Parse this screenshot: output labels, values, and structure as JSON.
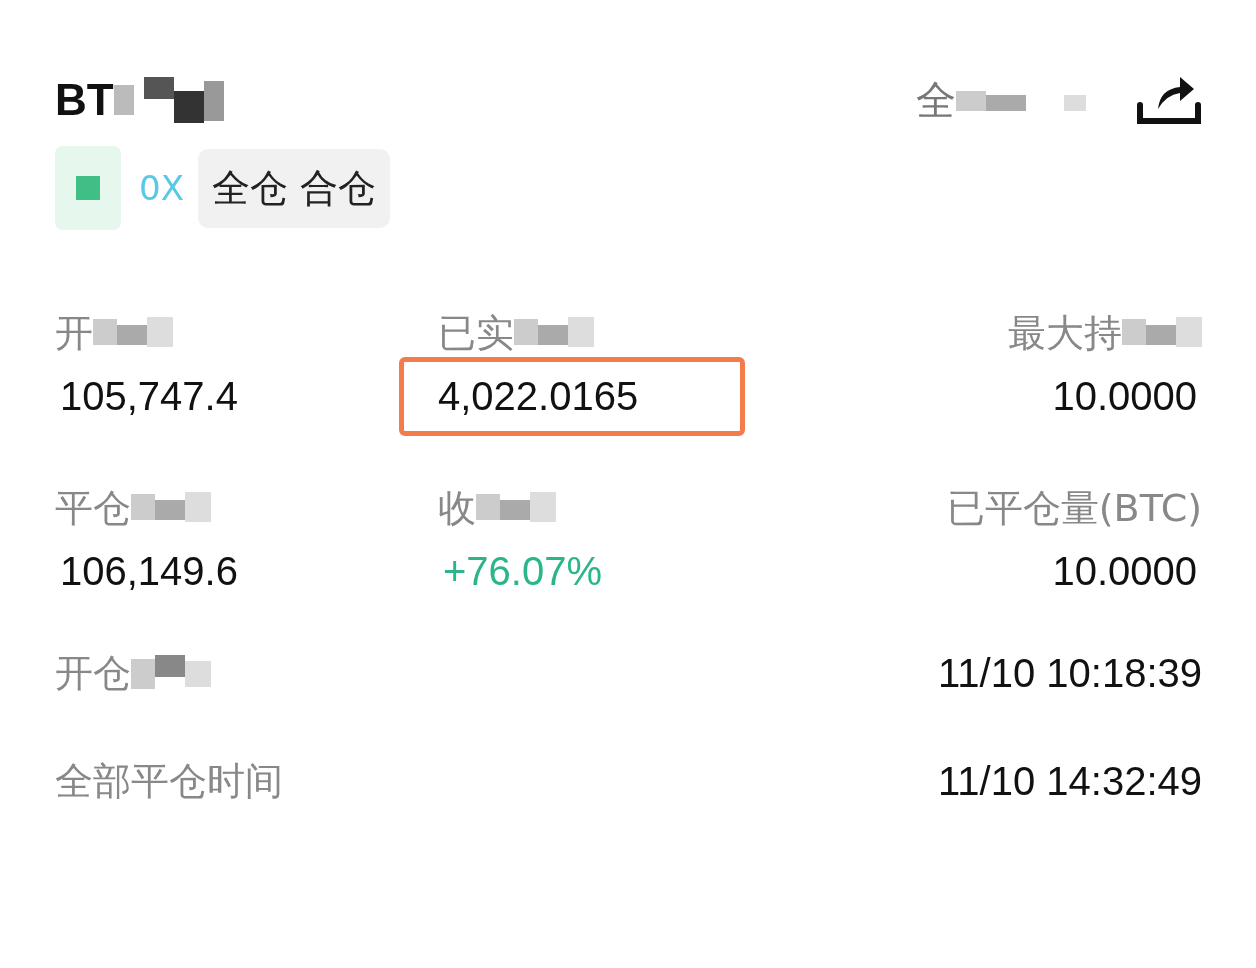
{
  "header": {
    "title": "BT",
    "filter": "全"
  },
  "tags": [
    {
      "kind": "exchange",
      "label": "0X"
    },
    {
      "kind": "mode",
      "label": "全仓 合仓"
    }
  ],
  "stats": [
    {
      "label": "开",
      "value": "105,747.4",
      "kind": "plain",
      "highlighted": false,
      "redacted": true
    },
    {
      "label": "已实",
      "value": "4,022.0165",
      "kind": "plain",
      "highlighted": true,
      "redacted": true
    },
    {
      "label": "最大持",
      "value": "10.0000",
      "kind": "plain",
      "highlighted": false,
      "redacted": true
    },
    {
      "label": "平仓",
      "value": "106,149.6",
      "kind": "plain",
      "highlighted": false,
      "redacted": true
    },
    {
      "label": "收",
      "value": "+76.07%",
      "kind": "positive",
      "highlighted": false,
      "redacted": true
    },
    {
      "label": "已平仓量(BTC)",
      "value": "10.0000",
      "kind": "plain",
      "highlighted": false,
      "redacted": false
    }
  ],
  "times": [
    {
      "label": "开仓",
      "value": "11/10 10:18:39",
      "redacted": true
    },
    {
      "label": "全部平仓时间",
      "value": "11/10 14:32:49",
      "redacted": false
    }
  ]
}
